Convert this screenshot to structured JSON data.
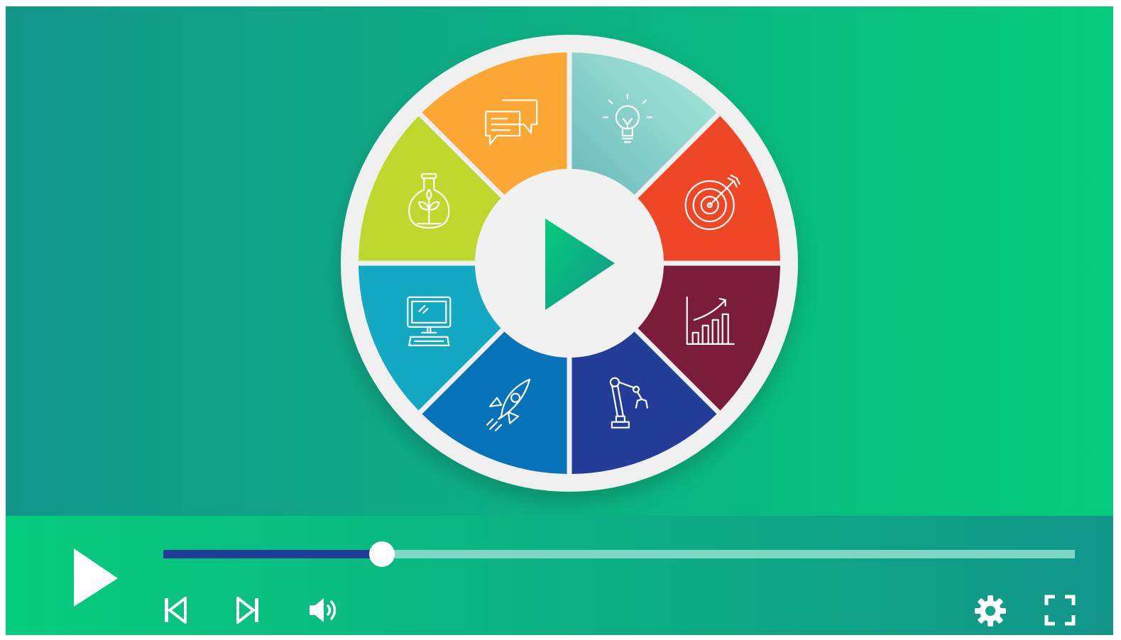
{
  "colors": {
    "gradient_teal": "#12968a",
    "gradient_green": "#05cc7c",
    "wheel_ring": "#f0f0f0",
    "play_center": "#0db47d",
    "progress_played": "#223c9a",
    "progress_remaining": "#7fd8c6"
  },
  "wheel": {
    "center_button_icon": "play-icon",
    "segments": [
      {
        "icon": "lightbulb-icon",
        "color": "#8fd8cc"
      },
      {
        "icon": "target-icon",
        "color": "#ef4726"
      },
      {
        "icon": "growth-chart-icon",
        "color": "#7b1c3a"
      },
      {
        "icon": "robot-arm-icon",
        "color": "#233d99"
      },
      {
        "icon": "rocket-icon",
        "color": "#0672b8"
      },
      {
        "icon": "computer-icon",
        "color": "#14a9c2"
      },
      {
        "icon": "flask-icon",
        "color": "#bfd82d"
      },
      {
        "icon": "chat-bubbles-icon",
        "color": "#fca733"
      }
    ]
  },
  "player": {
    "progress": 0.24,
    "buttons": [
      {
        "name": "play-button",
        "icon": "play-icon"
      },
      {
        "name": "previous-button",
        "icon": "skip-previous-icon"
      },
      {
        "name": "next-button",
        "icon": "skip-next-icon"
      },
      {
        "name": "volume-button",
        "icon": "volume-icon"
      },
      {
        "name": "settings-button",
        "icon": "gear-icon"
      },
      {
        "name": "fullscreen-button",
        "icon": "fullscreen-icon"
      }
    ]
  }
}
